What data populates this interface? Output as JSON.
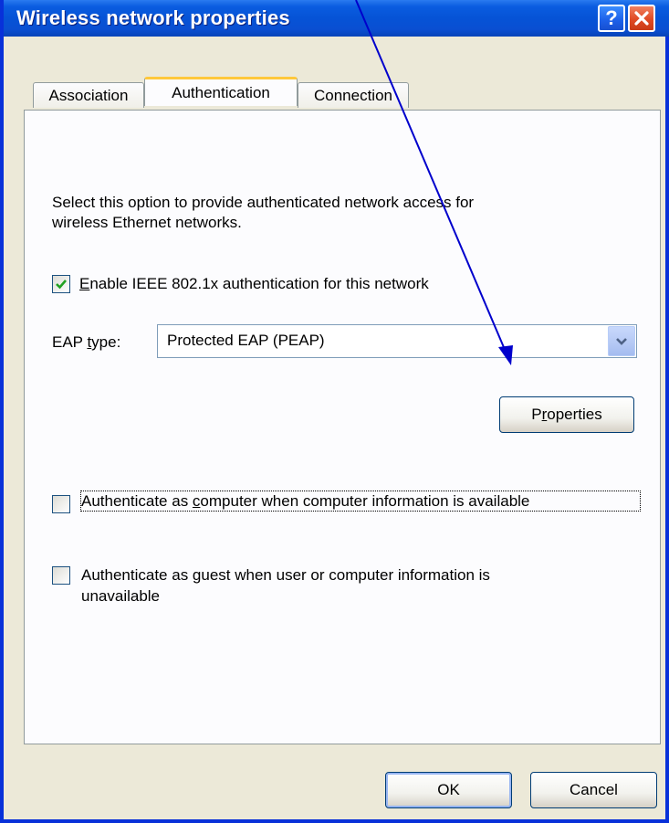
{
  "window": {
    "title": "Wireless network properties"
  },
  "tabs": [
    {
      "label": "Association",
      "active": false
    },
    {
      "label": "Authentication",
      "active": true
    },
    {
      "label": "Connection",
      "active": false
    }
  ],
  "auth": {
    "description_line1": "Select this option to provide authenticated network access for",
    "description_line2": "wireless Ethernet networks.",
    "enable_8021x": {
      "mnemonic": "E",
      "label_rest": "nable IEEE 802.1x authentication for this network",
      "checked": true
    },
    "eap_type": {
      "label_before": "EAP ",
      "mnemonic": "t",
      "label_after": "ype:",
      "selected": "Protected EAP (PEAP)"
    },
    "properties_button": {
      "before": "P",
      "mnemonic": "r",
      "after": "operties"
    },
    "auth_as_computer": {
      "before": "Authenticate as ",
      "mnemonic": "c",
      "after": "omputer when computer information is available",
      "checked": false
    },
    "auth_as_guest": {
      "before": "Authenticate as ",
      "mnemonic": "g",
      "after": "uest when user or computer information is",
      "line2": "unavailable",
      "checked": false
    }
  },
  "footer": {
    "ok_label": "OK",
    "cancel_label": "Cancel"
  },
  "colors": {
    "titlebar": "#0a52d8",
    "dialog_bg": "#ece9d8",
    "active_tab_accent": "#ffc83c",
    "annotation_arrow": "#0000cc"
  },
  "icons": {
    "help": "question-mark-icon",
    "close": "x-icon",
    "checkmark": "checkmark-icon",
    "dropdown": "chevron-down-icon"
  }
}
